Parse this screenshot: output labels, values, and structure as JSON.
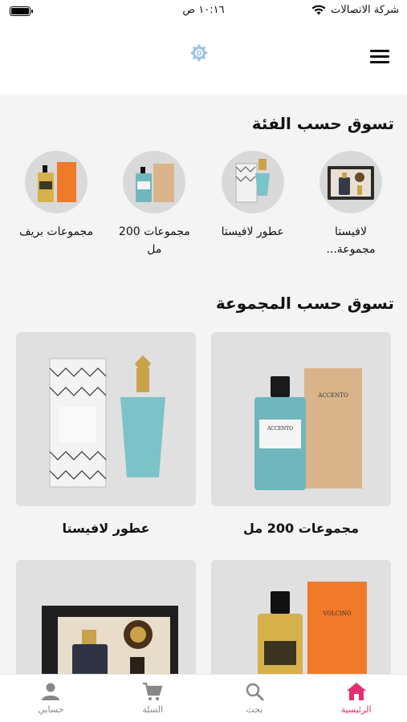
{
  "status_bar": {
    "carrier": "شركة الاتصالات",
    "time": "١٠:١٦ ص"
  },
  "header": {
    "logo_icon": "brand-logo-icon",
    "menu_icon": "hamburger-menu-icon"
  },
  "categories_section": {
    "title": "تسوق حسب الفئة",
    "items": [
      {
        "label": "لافيستا مجموعة..."
      },
      {
        "label": "عطور لافيستا"
      },
      {
        "label": "مجموعات 200 مل"
      },
      {
        "label": "مجموعات بريف"
      }
    ]
  },
  "collections_section": {
    "title": "تسوق حسب المجموعة",
    "cards": [
      {
        "label": "مجموعات 200 مل"
      },
      {
        "label": "عطور لافيستا"
      },
      {
        "label": ""
      },
      {
        "label": ""
      }
    ]
  },
  "bottom_nav": {
    "items": [
      {
        "label": "الرئيسية",
        "icon": "home-icon",
        "active": true
      },
      {
        "label": "بحث",
        "icon": "search-icon",
        "active": false
      },
      {
        "label": "السلة",
        "icon": "cart-icon",
        "active": false
      },
      {
        "label": "حسابي",
        "icon": "user-icon",
        "active": false
      }
    ]
  },
  "colors": {
    "accent": "#e52e6f",
    "background": "#f4f4f4"
  }
}
